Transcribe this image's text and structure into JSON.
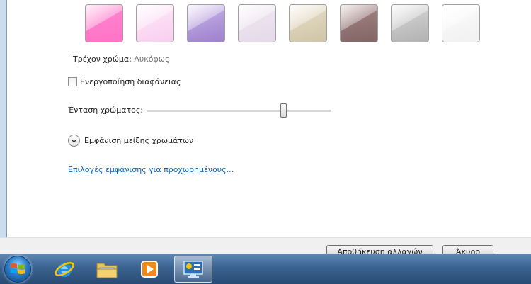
{
  "colors": {
    "swatches": [
      {
        "name": "pink",
        "top": "#ff9ad6",
        "bottom": "#ff5cbe"
      },
      {
        "name": "light-pink",
        "top": "#fff0fb",
        "bottom": "#f7c7ec"
      },
      {
        "name": "violet",
        "top": "#d7c8ef",
        "bottom": "#8e6cc6"
      },
      {
        "name": "lilac",
        "top": "#f4eef6",
        "bottom": "#e1d4e5"
      },
      {
        "name": "taupe",
        "top": "#efe8d8",
        "bottom": "#c8bb98"
      },
      {
        "name": "brown",
        "top": "#b89a9a",
        "bottom": "#6d4d4d"
      },
      {
        "name": "gray",
        "top": "#e2e2e2",
        "bottom": "#a6a6a6"
      },
      {
        "name": "white",
        "top": "#ffffff",
        "bottom": "#eeeeee"
      }
    ],
    "link": "#0066cc"
  },
  "current_color": {
    "label": "Τρέχον χρώμα:",
    "value": "Λυκόφως"
  },
  "transparency": {
    "label": "Ενεργοποίηση διαφάνειας",
    "checked": false
  },
  "intensity": {
    "label": "Ένταση χρώματος:",
    "value_percent": 74
  },
  "mixer": {
    "label": "Εμφάνιση μείξης χρωμάτων",
    "icon": "chevron-down-icon"
  },
  "advanced_link": "Επιλογές εμφάνισης για προχωρημένους...",
  "buttons": {
    "save": "Αποθήκευση αλλαγών",
    "cancel": "Άκυρο"
  },
  "taskbar": {
    "items": [
      {
        "name": "internet-explorer",
        "icon": "ie-icon",
        "active": false
      },
      {
        "name": "windows-explorer",
        "icon": "folder-icon",
        "active": false
      },
      {
        "name": "media-player",
        "icon": "media-player-icon",
        "active": false
      },
      {
        "name": "personalization",
        "icon": "display-icon",
        "active": true
      }
    ]
  }
}
